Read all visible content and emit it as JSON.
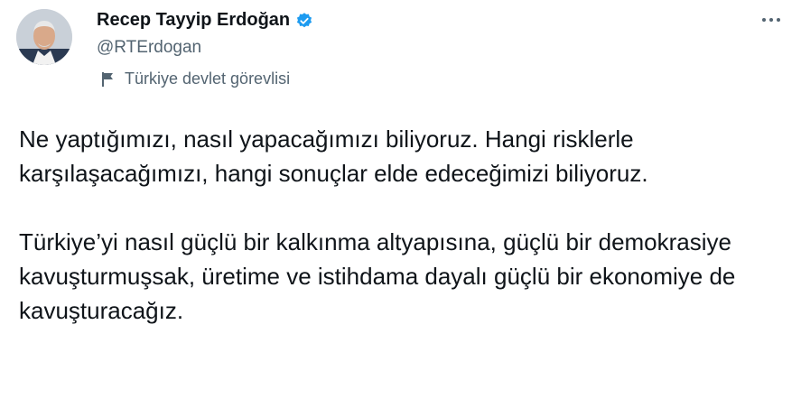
{
  "author": {
    "display_name": "Recep Tayyip Erdoğan",
    "handle": "@RTErdogan",
    "verified": true,
    "account_label": "Türkiye devlet görevlisi"
  },
  "icons": {
    "avatar": "profile-photo",
    "verified": "verified-badge-icon",
    "label": "flag-icon",
    "more": "more-options-icon"
  },
  "colors": {
    "text": "#0f1419",
    "secondary": "#536471",
    "verified": "#1d9bf0"
  },
  "tweet": {
    "paragraphs": [
      "Ne yaptığımızı, nasıl yapacağımızı biliyoruz. Hangi risklerle karşılaşacağımızı, hangi sonuçlar elde edeceğimizi biliyoruz.",
      "Türkiye’yi nasıl güçlü bir kalkınma altyapısına, güçlü bir demokrasiye kavuşturmuşsak, üretime ve istihdama dayalı güçlü bir ekonomiye de kavuşturacağız."
    ]
  }
}
